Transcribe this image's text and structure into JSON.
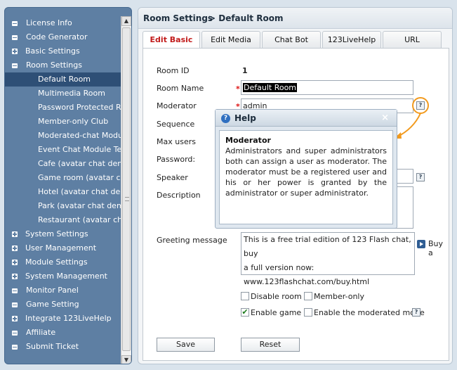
{
  "sidebar": {
    "items": [
      {
        "label": "License Info",
        "type": "top",
        "marker": "bullet"
      },
      {
        "label": "Code Generator",
        "type": "top",
        "marker": "bullet"
      },
      {
        "label": "Basic Settings",
        "type": "top",
        "marker": "plus"
      },
      {
        "label": "Room Settings",
        "type": "top",
        "marker": "bullet"
      },
      {
        "label": "Default Room",
        "type": "sub",
        "selected": true
      },
      {
        "label": "Multimedia Room",
        "type": "sub"
      },
      {
        "label": "Password Protected Roc",
        "type": "sub"
      },
      {
        "label": "Member-only Club",
        "type": "sub"
      },
      {
        "label": "Moderated-chat Module",
        "type": "sub"
      },
      {
        "label": "Event Chat Module Test",
        "type": "sub"
      },
      {
        "label": "Cafe (avatar chat demo)",
        "type": "sub"
      },
      {
        "label": "Game room (avatar chat",
        "type": "sub"
      },
      {
        "label": "Hotel (avatar chat demo",
        "type": "sub"
      },
      {
        "label": "Park (avatar chat demo)",
        "type": "sub"
      },
      {
        "label": "Restaurant (avatar chat",
        "type": "sub"
      },
      {
        "label": "System Settings",
        "type": "top",
        "marker": "plus"
      },
      {
        "label": "User Management",
        "type": "top",
        "marker": "plus"
      },
      {
        "label": "Module Settings",
        "type": "top",
        "marker": "plus"
      },
      {
        "label": "System Management",
        "type": "top",
        "marker": "plus"
      },
      {
        "label": "Monitor Panel",
        "type": "top",
        "marker": "bullet"
      },
      {
        "label": "Game Setting",
        "type": "top",
        "marker": "bullet"
      },
      {
        "label": "Integrate 123LiveHelp",
        "type": "top",
        "marker": "plus"
      },
      {
        "label": "Affiliate",
        "type": "top",
        "marker": "bullet"
      },
      {
        "label": "Submit Ticket",
        "type": "top",
        "marker": "bullet"
      }
    ]
  },
  "breadcrumb": {
    "section": "Room Settings",
    "current": "> Default Room"
  },
  "tabs": [
    {
      "label": "Edit Basic",
      "active": true
    },
    {
      "label": "Edit Media"
    },
    {
      "label": "Chat Bot"
    },
    {
      "label": "123LiveHelp"
    },
    {
      "label": "URL"
    }
  ],
  "form": {
    "room_id_label": "Room ID",
    "room_id_value": "1",
    "room_name_label": "Room Name",
    "room_name_value": "Default Room",
    "moderator_label": "Moderator",
    "moderator_value": "admin",
    "sequence_label": "Sequence",
    "max_users_label": "Max users",
    "password_label": "Password:",
    "speaker_label": "Speaker",
    "description_label": "Description",
    "greeting_label": "Greeting message",
    "greeting_lines": [
      "This is a free trial edition of 123 Flash chat, buy",
      "a full version now:",
      "www.123flashchat.com/buy.html"
    ],
    "buy_label": "Buy a",
    "required_mark": "*",
    "help_mark": "?",
    "checkboxes": {
      "disable_room": {
        "label": "Disable room",
        "checked": false
      },
      "member_only": {
        "label": "Member-only",
        "checked": false
      },
      "enable_game": {
        "label": "Enable game",
        "checked": true
      },
      "moderated_mode": {
        "label": "Enable the moderated mode",
        "checked": false
      }
    },
    "check_glyph": "✔",
    "save_label": "Save",
    "reset_label": "Reset"
  },
  "help_popup": {
    "title": "Help",
    "close": "×",
    "heading": "Moderator",
    "text": "Administrators and super administrators both can assign a user as moderator. The moderator must be a registered user and his or her power is granted by the  administrator or super administrator."
  },
  "colors": {
    "sidebar_bg": "#5e7fa3",
    "sidebar_selected": "#2e4f76",
    "active_tab_text": "#c11b1b",
    "callout": "#f29a1d"
  }
}
